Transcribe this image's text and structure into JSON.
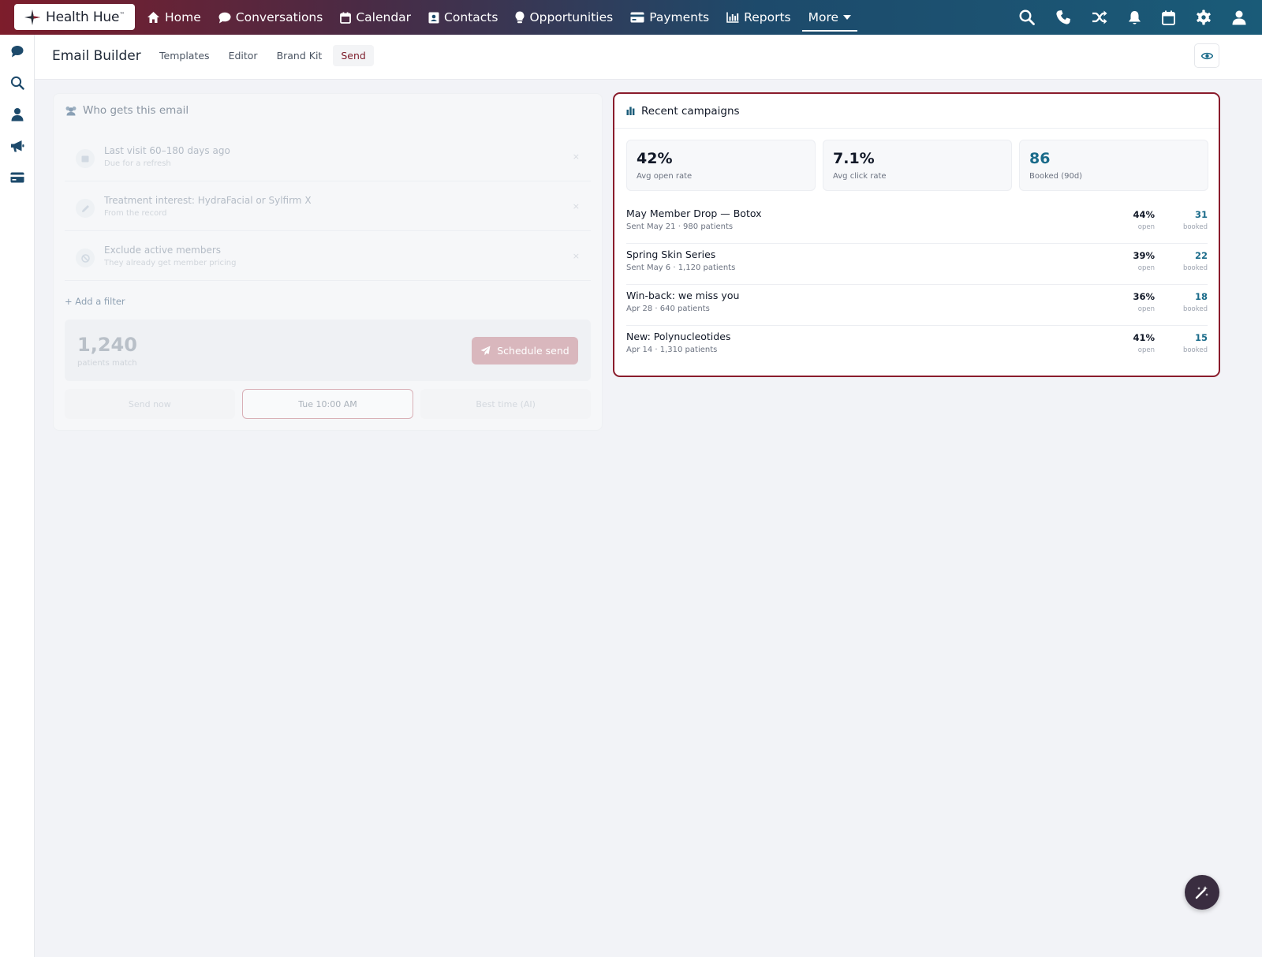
{
  "brand": {
    "name": "Health Hue",
    "mark": "™"
  },
  "nav": {
    "items": [
      {
        "label": "Home",
        "icon": "home-icon"
      },
      {
        "label": "Conversations",
        "icon": "chat-icon"
      },
      {
        "label": "Calendar",
        "icon": "calendar-icon"
      },
      {
        "label": "Contacts",
        "icon": "contact-card-icon"
      },
      {
        "label": "Opportunities",
        "icon": "lightbulb-icon"
      },
      {
        "label": "Payments",
        "icon": "credit-card-icon"
      },
      {
        "label": "Reports",
        "icon": "bar-chart-icon"
      },
      {
        "label": "More",
        "icon": "caret-down-icon"
      }
    ],
    "right_icons": [
      "search-icon",
      "phone-icon",
      "shuffle-icon",
      "bell-icon",
      "calendar-icon",
      "gear-icon",
      "user-icon"
    ]
  },
  "rail_icons": [
    "chat-icon",
    "search-icon",
    "user-icon",
    "megaphone-icon",
    "credit-card-icon"
  ],
  "subheader": {
    "title": "Email Builder",
    "tabs": [
      "Templates",
      "Editor",
      "Brand Kit",
      "Send"
    ],
    "active_tab": "Send"
  },
  "audience": {
    "heading": "Who gets this email",
    "filters": [
      {
        "title": "Last visit 60–180 days ago",
        "sub": "Due for a refresh",
        "close": "×"
      },
      {
        "title": "Treatment interest: HydraFacial or Sylfirm X",
        "sub": "From the record",
        "close": "×"
      },
      {
        "title": "Exclude active members",
        "sub": "They already get member pricing",
        "close": "×"
      }
    ],
    "add_filter": "+ Add a filter",
    "match_count": "1,240",
    "match_label": "patients match",
    "schedule_label": "Schedule send",
    "timing": [
      "Send now",
      "Tue 10:00 AM",
      "Best time (AI)"
    ]
  },
  "campaigns": {
    "heading": "Recent campaigns",
    "stats": [
      {
        "value": "42%",
        "label": "Avg open rate"
      },
      {
        "value": "7.1%",
        "label": "Avg click rate"
      },
      {
        "value": "86",
        "label": "Booked (90d)"
      }
    ],
    "rows": [
      {
        "name": "May Member Drop — Botox",
        "meta": "Sent May 21 · 980 patients",
        "open": "44%",
        "open_label": "open",
        "booked": "31",
        "booked_label": "booked"
      },
      {
        "name": "Spring Skin Series",
        "meta": "Sent May 6 · 1,120 patients",
        "open": "39%",
        "open_label": "open",
        "booked": "22",
        "booked_label": "booked"
      },
      {
        "name": "Win-back: we miss you",
        "meta": "Apr 28 · 640 patients",
        "open": "36%",
        "open_label": "open",
        "booked": "18",
        "booked_label": "booked"
      },
      {
        "name": "New: Polynucleotides",
        "meta": "Apr 14 · 1,310 patients",
        "open": "41%",
        "open_label": "open",
        "booked": "15",
        "booked_label": "booked"
      }
    ]
  },
  "colors": {
    "brand_red": "#8a1c2c",
    "accent_teal": "#1a6b8a",
    "fab": "#3a2d40"
  }
}
